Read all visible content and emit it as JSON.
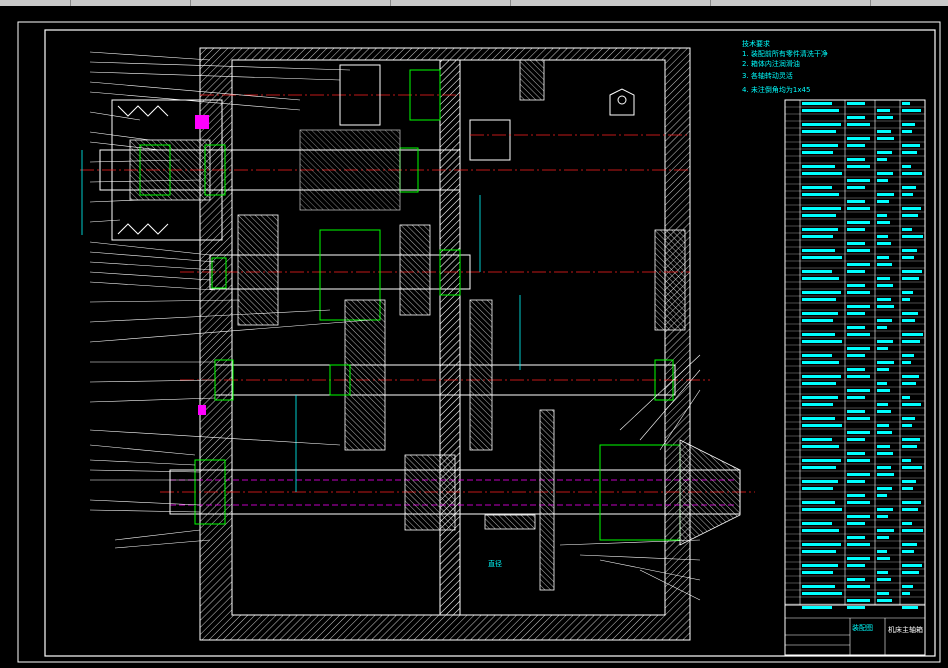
{
  "viewer": {
    "background": "#000000",
    "frame_color": "#ffffff",
    "title_block": {
      "drawing_name": "机床主轴箱",
      "note_label": "装配图"
    },
    "tech_notes": [
      "技术要求",
      "1. 装配前所有零件清洗干净",
      "2. 箱体内注润滑油",
      "3. 各轴转动灵活",
      "4. 未注倒角均为1x45"
    ],
    "tech_label": "直径",
    "colors": {
      "outline": "#ffffff",
      "hatch": "#ffffff",
      "centerline": "#ff2020",
      "bearing": "#00ff00",
      "cyan": "#00ffff",
      "magenta": "#ff00ff",
      "yellow": "#ffff00"
    }
  }
}
